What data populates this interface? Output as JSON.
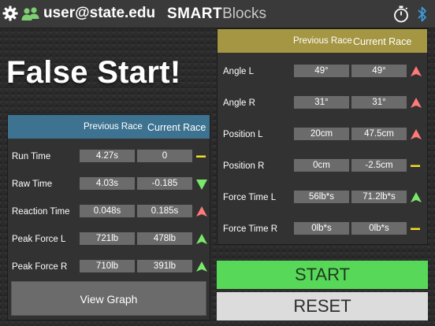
{
  "header": {
    "username": "user@state.edu",
    "brand_bold": "SMART",
    "brand_light": "Blocks",
    "icons": [
      "gear-icon",
      "users-icon",
      "stopwatch-icon",
      "bluetooth-icon"
    ]
  },
  "status_title": "False Start!",
  "colors": {
    "left_header": "#3d7391",
    "right_header": "#a49642",
    "up": "#ff7a7a",
    "down": "#7ae86a",
    "same": "#f0de20",
    "start": "#58d858",
    "reset": "#dcdcdc"
  },
  "left_table": {
    "col_previous": "Previous Race",
    "col_current": "Current Race",
    "rows": [
      {
        "label": "Run Time",
        "previous": "4.27s",
        "current": "0",
        "indicator": "same"
      },
      {
        "label": "Raw Time",
        "previous": "4.03s",
        "current": "-0.185",
        "indicator": "down-green"
      },
      {
        "label": "Reaction Time",
        "previous": "0.048s",
        "current": "0.185s",
        "indicator": "up-red"
      },
      {
        "label": "Peak Force L",
        "previous": "721lb",
        "current": "478lb",
        "indicator": "up-green"
      },
      {
        "label": "Peak Force R",
        "previous": "710lb",
        "current": "391lb",
        "indicator": "up-green"
      }
    ]
  },
  "right_table": {
    "col_previous": "Previous Race",
    "col_current": "Current Race",
    "rows": [
      {
        "label": "Angle L",
        "previous": "49°",
        "current": "49°",
        "indicator": "up-red"
      },
      {
        "label": "Angle R",
        "previous": "31°",
        "current": "31°",
        "indicator": "up-red"
      },
      {
        "label": "Position L",
        "previous": "20cm",
        "current": "47.5cm",
        "indicator": "up-red"
      },
      {
        "label": "Position R",
        "previous": "0cm",
        "current": "-2.5cm",
        "indicator": "same"
      },
      {
        "label": "Force Time L",
        "previous": "56lb*s",
        "current": "71.2lb*s",
        "indicator": "up-green"
      },
      {
        "label": "Force Time R",
        "previous": "0lb*s",
        "current": "0lb*s",
        "indicator": "same"
      }
    ]
  },
  "buttons": {
    "view_graph": "View Graph",
    "start": "START",
    "reset": "RESET"
  }
}
